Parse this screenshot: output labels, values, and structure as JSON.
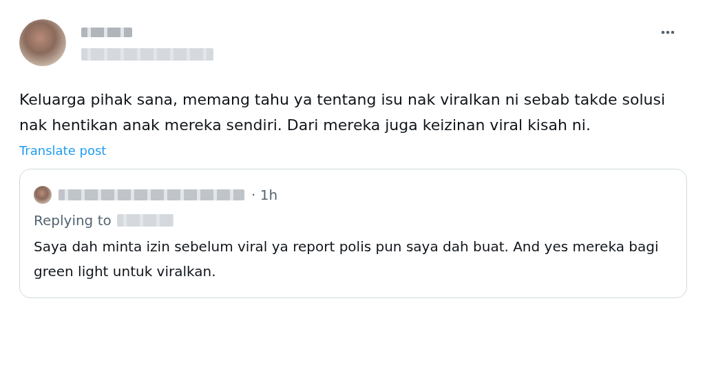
{
  "post": {
    "text": "Keluarga pihak sana, memang tahu ya tentang isu nak viralkan ni sebab takde solusi nak hentikan anak mereka sendiri. Dari mereka juga keizinan viral kisah ni.",
    "translate_link": "Translate post"
  },
  "quoted_post": {
    "time": "· 1h",
    "replying_label": "Replying to",
    "text": "Saya dah minta izin sebelum viral ya report polis pun saya dah buat. And yes mereka bagi green light untuk viralkan."
  }
}
